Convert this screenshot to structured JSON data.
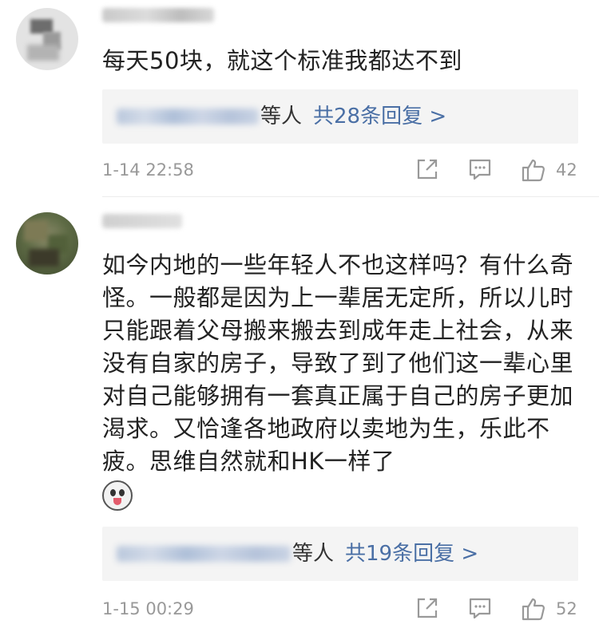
{
  "comments": [
    {
      "content": "每天50块，就这个标准我都达不到",
      "reply": {
        "suffix": "等人",
        "count_label": "共28条回复 >"
      },
      "timestamp": "1-14 22:58",
      "likes": "42"
    },
    {
      "content": "如今内地的一些年轻人不也这样吗？有什么奇怪。一般都是因为上一辈居无定所，所以儿时只能跟着父母搬来搬去到成年走上社会，从来没有自家的房子，导致了到了他们这一辈心里对自己能够拥有一套真正属于自己的房子更加渴求。又恰逢各地政府以卖地为生，乐此不疲。思维自然就和HK一样了",
      "reply": {
        "suffix": "等人",
        "count_label": "共19条回复 >"
      },
      "timestamp": "1-15 00:29",
      "likes": "52"
    }
  ],
  "icons": {
    "share": "share-icon",
    "comment": "comment-icon",
    "like": "thumbs-up-icon",
    "emoji": "dog-emoji-icon"
  },
  "colors": {
    "reply_link": "#4a6fa5",
    "meta_gray": "#999999",
    "reply_bg": "#f4f4f4"
  }
}
